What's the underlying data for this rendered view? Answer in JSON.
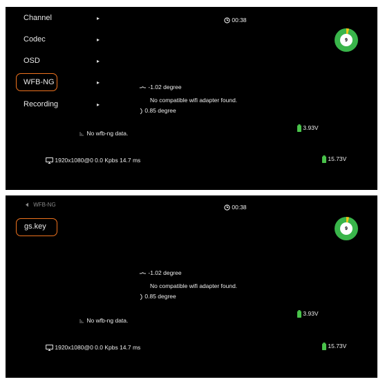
{
  "colors": {
    "accent": "#f0731e",
    "battery": "#49c34a",
    "ring": "#39b54a",
    "ring_notch": "#f5c518"
  },
  "screen1": {
    "menu": [
      {
        "label": "Channel"
      },
      {
        "label": "Codec"
      },
      {
        "label": "OSD"
      },
      {
        "label": "WFB-NG"
      },
      {
        "label": "Recording"
      }
    ],
    "chevron": "▸",
    "timer": "00:38",
    "ring_value": "9",
    "roll": "-1.02 degree",
    "adapter_msg": "No compatible wifi adapter found.",
    "pitch": "0.85 degree",
    "battery1": "3.93V",
    "wfb_status": "No wfb-ng data.",
    "video_info": "1920x1080@0  0.0 Kpbs  14.7 ms",
    "battery2": "15.73V"
  },
  "screen2": {
    "back_label": "WFB-NG",
    "menu": [
      {
        "label": "gs.key"
      }
    ],
    "timer": "00:38",
    "ring_value": "9",
    "roll": "-1.02 degree",
    "adapter_msg": "No compatible wifi adapter found.",
    "pitch": "0.85 degree",
    "battery1": "3.93V",
    "wfb_status": "No wfb-ng data.",
    "video_info": "1920x1080@0  0.0 Kpbs  14.7 ms",
    "battery2": "15.73V"
  }
}
